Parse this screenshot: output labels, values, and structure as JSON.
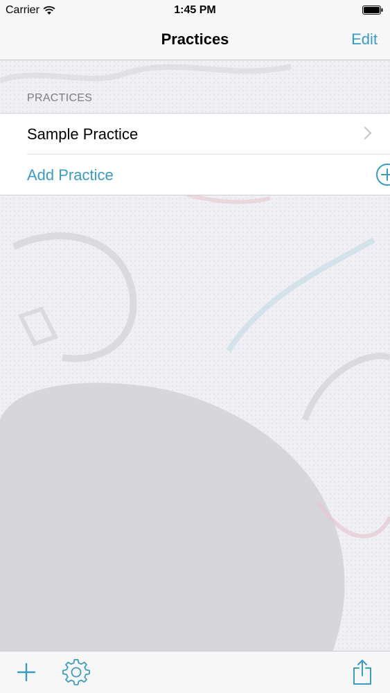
{
  "status_bar": {
    "carrier": "Carrier",
    "time": "1:45 PM",
    "icons": [
      "wifi-icon",
      "battery-icon"
    ]
  },
  "nav": {
    "title": "Practices",
    "edit_label": "Edit"
  },
  "table": {
    "section_header": "PRACTICES",
    "rows": [
      {
        "label": "Sample Practice",
        "accessory": "chevron-right-icon"
      },
      {
        "label": "Add Practice",
        "accessory": "add-circle-icon"
      }
    ]
  },
  "toolbar": {
    "items": [
      "plus-icon",
      "gear-icon",
      "share-icon"
    ]
  },
  "colors": {
    "tint": "#3a9bbf",
    "background": "#f0f0f4",
    "bar": "#f7f7f7"
  }
}
